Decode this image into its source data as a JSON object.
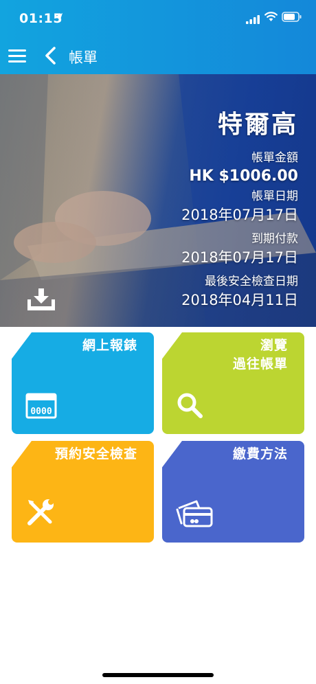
{
  "status_bar": {
    "time": "01:15"
  },
  "nav": {
    "title": "帳單"
  },
  "bill": {
    "customer": "特爾高",
    "amount_label": "帳單金額",
    "amount": "HK $1006.00",
    "bill_date_label": "帳單日期",
    "bill_date": "2018年07月17日",
    "due_label": "到期付款",
    "due_date": "2018年07月17日",
    "inspection_label": "最後安全檢查日期",
    "inspection_date": "2018年04月11日"
  },
  "tiles": [
    {
      "label": "網上報錶",
      "color": "#16ace4",
      "icon": "meter-counter-icon"
    },
    {
      "label_line1": "瀏覽",
      "label_line2": "過往帳單",
      "color": "#bcd531",
      "icon": "magnifier-icon"
    },
    {
      "label": "預約安全檢查",
      "color": "#fdb515",
      "icon": "wrench-screwdriver-icon"
    },
    {
      "label": "繳費方法",
      "color": "#4a66cc",
      "icon": "credit-cards-icon"
    }
  ],
  "colors": {
    "header": "#1488d9",
    "text_on_color": "#ffffff"
  }
}
